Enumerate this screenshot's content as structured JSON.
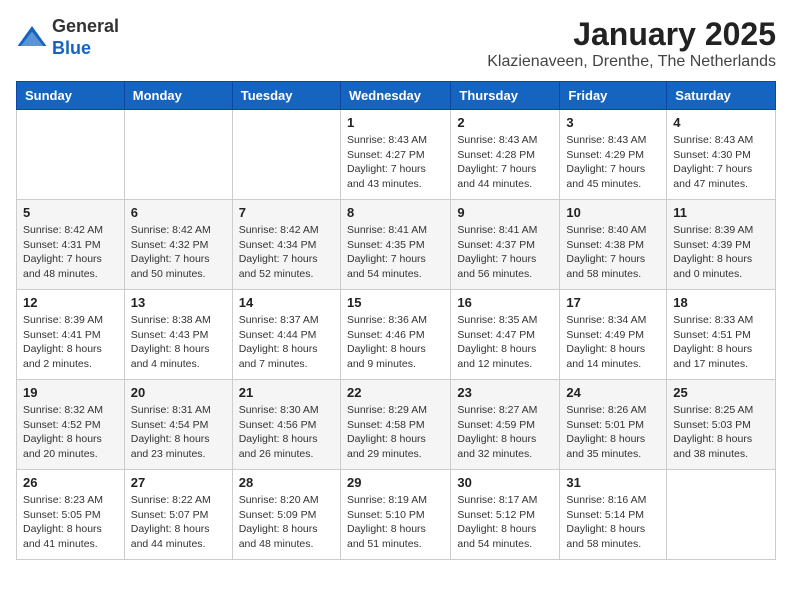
{
  "header": {
    "logo_line1": "General",
    "logo_line2": "Blue",
    "title": "January 2025",
    "subtitle": "Klazienaveen, Drenthe, The Netherlands"
  },
  "days_of_week": [
    "Sunday",
    "Monday",
    "Tuesday",
    "Wednesday",
    "Thursday",
    "Friday",
    "Saturday"
  ],
  "weeks": [
    [
      {
        "day": "",
        "info": ""
      },
      {
        "day": "",
        "info": ""
      },
      {
        "day": "",
        "info": ""
      },
      {
        "day": "1",
        "info": "Sunrise: 8:43 AM\nSunset: 4:27 PM\nDaylight: 7 hours\nand 43 minutes."
      },
      {
        "day": "2",
        "info": "Sunrise: 8:43 AM\nSunset: 4:28 PM\nDaylight: 7 hours\nand 44 minutes."
      },
      {
        "day": "3",
        "info": "Sunrise: 8:43 AM\nSunset: 4:29 PM\nDaylight: 7 hours\nand 45 minutes."
      },
      {
        "day": "4",
        "info": "Sunrise: 8:43 AM\nSunset: 4:30 PM\nDaylight: 7 hours\nand 47 minutes."
      }
    ],
    [
      {
        "day": "5",
        "info": "Sunrise: 8:42 AM\nSunset: 4:31 PM\nDaylight: 7 hours\nand 48 minutes."
      },
      {
        "day": "6",
        "info": "Sunrise: 8:42 AM\nSunset: 4:32 PM\nDaylight: 7 hours\nand 50 minutes."
      },
      {
        "day": "7",
        "info": "Sunrise: 8:42 AM\nSunset: 4:34 PM\nDaylight: 7 hours\nand 52 minutes."
      },
      {
        "day": "8",
        "info": "Sunrise: 8:41 AM\nSunset: 4:35 PM\nDaylight: 7 hours\nand 54 minutes."
      },
      {
        "day": "9",
        "info": "Sunrise: 8:41 AM\nSunset: 4:37 PM\nDaylight: 7 hours\nand 56 minutes."
      },
      {
        "day": "10",
        "info": "Sunrise: 8:40 AM\nSunset: 4:38 PM\nDaylight: 7 hours\nand 58 minutes."
      },
      {
        "day": "11",
        "info": "Sunrise: 8:39 AM\nSunset: 4:39 PM\nDaylight: 8 hours\nand 0 minutes."
      }
    ],
    [
      {
        "day": "12",
        "info": "Sunrise: 8:39 AM\nSunset: 4:41 PM\nDaylight: 8 hours\nand 2 minutes."
      },
      {
        "day": "13",
        "info": "Sunrise: 8:38 AM\nSunset: 4:43 PM\nDaylight: 8 hours\nand 4 minutes."
      },
      {
        "day": "14",
        "info": "Sunrise: 8:37 AM\nSunset: 4:44 PM\nDaylight: 8 hours\nand 7 minutes."
      },
      {
        "day": "15",
        "info": "Sunrise: 8:36 AM\nSunset: 4:46 PM\nDaylight: 8 hours\nand 9 minutes."
      },
      {
        "day": "16",
        "info": "Sunrise: 8:35 AM\nSunset: 4:47 PM\nDaylight: 8 hours\nand 12 minutes."
      },
      {
        "day": "17",
        "info": "Sunrise: 8:34 AM\nSunset: 4:49 PM\nDaylight: 8 hours\nand 14 minutes."
      },
      {
        "day": "18",
        "info": "Sunrise: 8:33 AM\nSunset: 4:51 PM\nDaylight: 8 hours\nand 17 minutes."
      }
    ],
    [
      {
        "day": "19",
        "info": "Sunrise: 8:32 AM\nSunset: 4:52 PM\nDaylight: 8 hours\nand 20 minutes."
      },
      {
        "day": "20",
        "info": "Sunrise: 8:31 AM\nSunset: 4:54 PM\nDaylight: 8 hours\nand 23 minutes."
      },
      {
        "day": "21",
        "info": "Sunrise: 8:30 AM\nSunset: 4:56 PM\nDaylight: 8 hours\nand 26 minutes."
      },
      {
        "day": "22",
        "info": "Sunrise: 8:29 AM\nSunset: 4:58 PM\nDaylight: 8 hours\nand 29 minutes."
      },
      {
        "day": "23",
        "info": "Sunrise: 8:27 AM\nSunset: 4:59 PM\nDaylight: 8 hours\nand 32 minutes."
      },
      {
        "day": "24",
        "info": "Sunrise: 8:26 AM\nSunset: 5:01 PM\nDaylight: 8 hours\nand 35 minutes."
      },
      {
        "day": "25",
        "info": "Sunrise: 8:25 AM\nSunset: 5:03 PM\nDaylight: 8 hours\nand 38 minutes."
      }
    ],
    [
      {
        "day": "26",
        "info": "Sunrise: 8:23 AM\nSunset: 5:05 PM\nDaylight: 8 hours\nand 41 minutes."
      },
      {
        "day": "27",
        "info": "Sunrise: 8:22 AM\nSunset: 5:07 PM\nDaylight: 8 hours\nand 44 minutes."
      },
      {
        "day": "28",
        "info": "Sunrise: 8:20 AM\nSunset: 5:09 PM\nDaylight: 8 hours\nand 48 minutes."
      },
      {
        "day": "29",
        "info": "Sunrise: 8:19 AM\nSunset: 5:10 PM\nDaylight: 8 hours\nand 51 minutes."
      },
      {
        "day": "30",
        "info": "Sunrise: 8:17 AM\nSunset: 5:12 PM\nDaylight: 8 hours\nand 54 minutes."
      },
      {
        "day": "31",
        "info": "Sunrise: 8:16 AM\nSunset: 5:14 PM\nDaylight: 8 hours\nand 58 minutes."
      },
      {
        "day": "",
        "info": ""
      }
    ]
  ]
}
